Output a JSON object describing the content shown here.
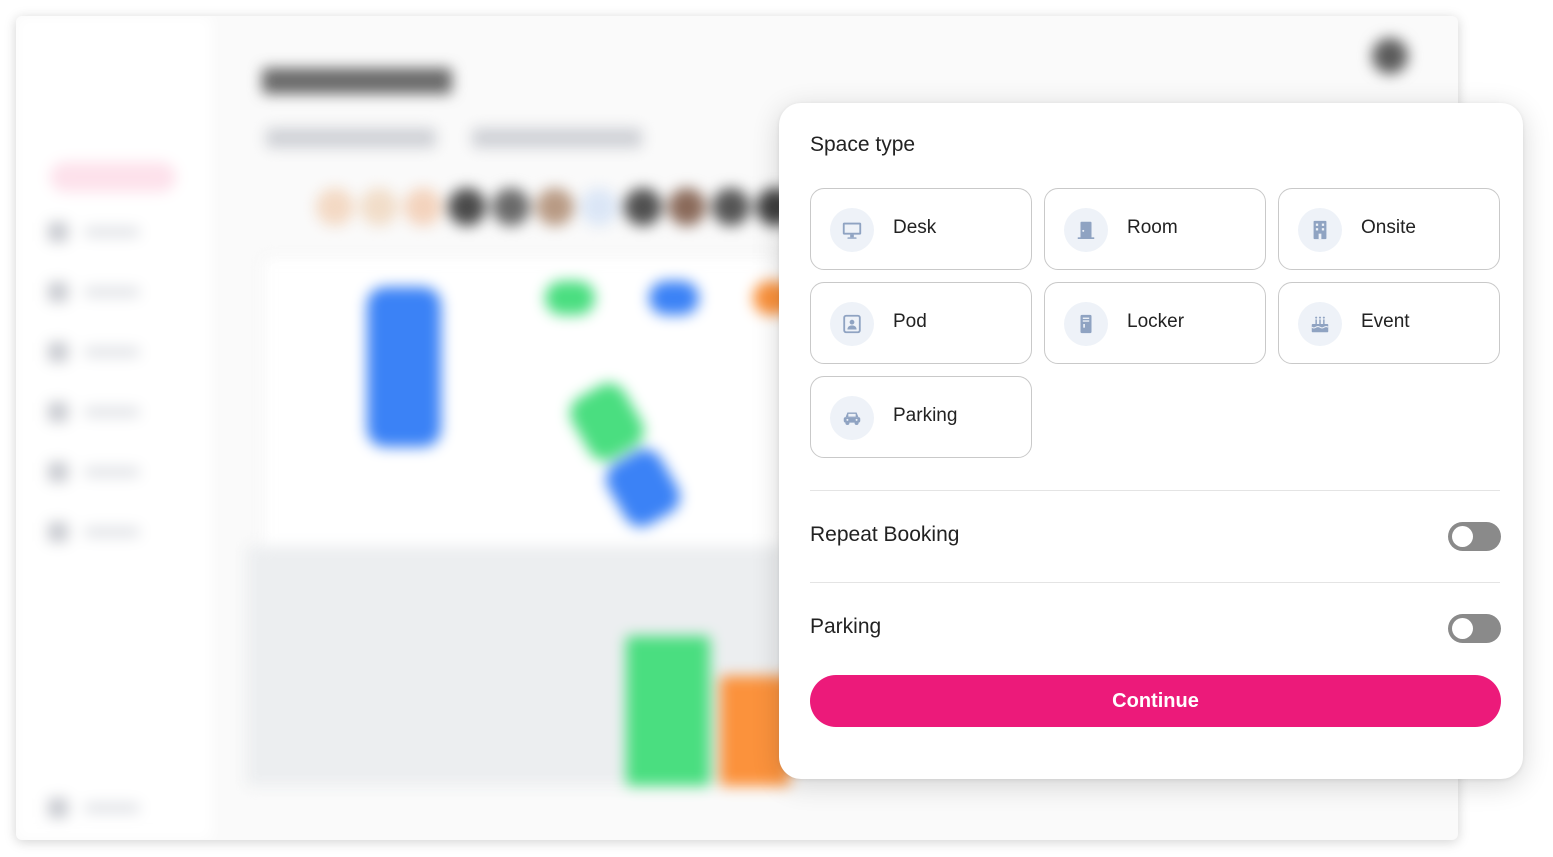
{
  "background_app": {
    "brand_color": "#f0477f",
    "status_colors": [
      "#3b82f6",
      "#4ade80",
      "#fb923c"
    ]
  },
  "modal": {
    "title": "Space type",
    "options": [
      {
        "label": "Desk",
        "icon": "monitor-icon"
      },
      {
        "label": "Room",
        "icon": "door-icon"
      },
      {
        "label": "Onsite",
        "icon": "building-icon"
      },
      {
        "label": "Pod",
        "icon": "pod-icon"
      },
      {
        "label": "Locker",
        "icon": "locker-icon"
      },
      {
        "label": "Event",
        "icon": "cake-icon"
      },
      {
        "label": "Parking",
        "icon": "car-icon"
      }
    ],
    "repeat_booking": {
      "label": "Repeat Booking",
      "enabled": false
    },
    "parking": {
      "label": "Parking",
      "enabled": false
    },
    "continue_label": "Continue",
    "accent_color": "#ec1a7a",
    "icon_color": "#8fa3c2"
  }
}
